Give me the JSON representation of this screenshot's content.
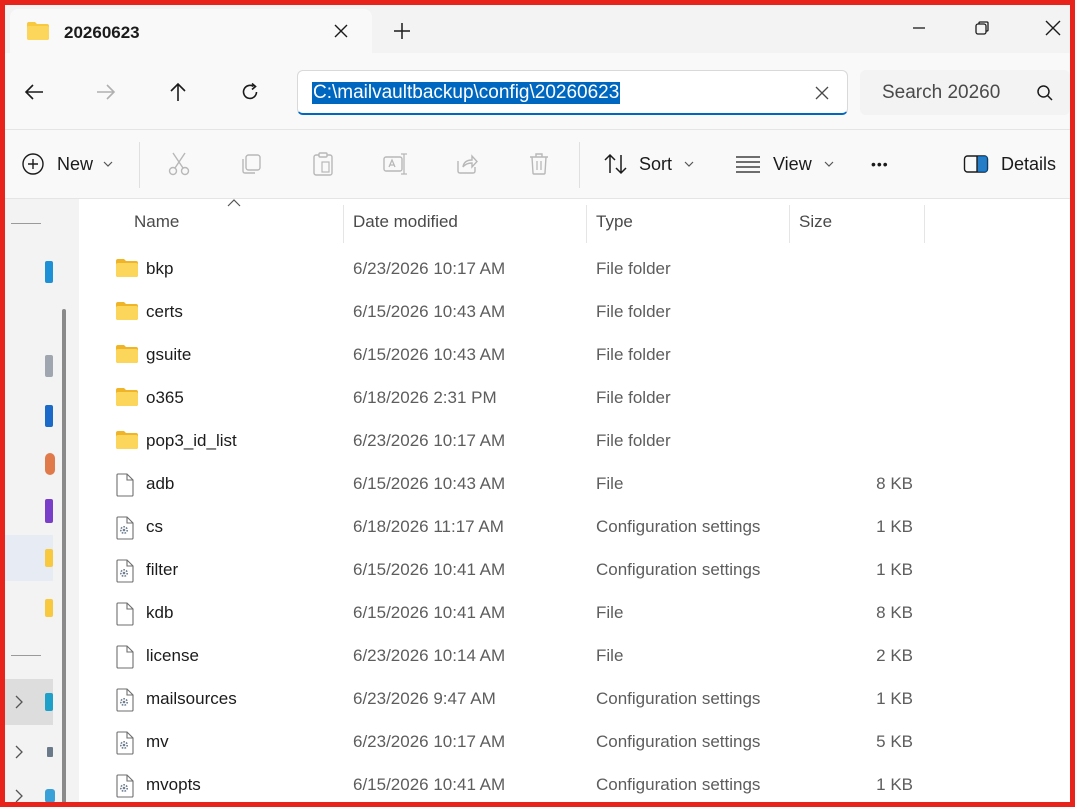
{
  "window": {
    "tab_title": "20260623",
    "new_tab_label": "+"
  },
  "nav": {
    "address": "C:\\mailvaultbackup\\config\\20260623",
    "search_placeholder": "Search 20260"
  },
  "toolbar": {
    "new_label": "New",
    "sort_label": "Sort",
    "view_label": "View",
    "more_label": "•••",
    "details_label": "Details"
  },
  "columns": {
    "name": "Name",
    "date": "Date modified",
    "type": "Type",
    "size": "Size"
  },
  "files": [
    {
      "name": "bkp",
      "date": "6/23/2026 10:17 AM",
      "type": "File folder",
      "size": "",
      "icon": "folder-icon"
    },
    {
      "name": "certs",
      "date": "6/15/2026 10:43 AM",
      "type": "File folder",
      "size": "",
      "icon": "folder-icon"
    },
    {
      "name": "gsuite",
      "date": "6/15/2026 10:43 AM",
      "type": "File folder",
      "size": "",
      "icon": "folder-icon"
    },
    {
      "name": "o365",
      "date": "6/18/2026 2:31 PM",
      "type": "File folder",
      "size": "",
      "icon": "folder-icon"
    },
    {
      "name": "pop3_id_list",
      "date": "6/23/2026 10:17 AM",
      "type": "File folder",
      "size": "",
      "icon": "folder-icon"
    },
    {
      "name": "adb",
      "date": "6/15/2026 10:43 AM",
      "type": "File",
      "size": "8 KB",
      "icon": "file-icon"
    },
    {
      "name": "cs",
      "date": "6/18/2026 11:17 AM",
      "type": "Configuration settings",
      "size": "1 KB",
      "icon": "config-file-icon"
    },
    {
      "name": "filter",
      "date": "6/15/2026 10:41 AM",
      "type": "Configuration settings",
      "size": "1 KB",
      "icon": "config-file-icon"
    },
    {
      "name": "kdb",
      "date": "6/15/2026 10:41 AM",
      "type": "File",
      "size": "8 KB",
      "icon": "file-icon"
    },
    {
      "name": "license",
      "date": "6/23/2026 10:14 AM",
      "type": "File",
      "size": "2 KB",
      "icon": "file-icon"
    },
    {
      "name": "mailsources",
      "date": "6/23/2026 9:47 AM",
      "type": "Configuration settings",
      "size": "1 KB",
      "icon": "config-file-icon"
    },
    {
      "name": "mv",
      "date": "6/23/2026 10:17 AM",
      "type": "Configuration settings",
      "size": "5 KB",
      "icon": "config-file-icon"
    },
    {
      "name": "mvopts",
      "date": "6/15/2026 10:41 AM",
      "type": "Configuration settings",
      "size": "1 KB",
      "icon": "config-file-icon"
    }
  ],
  "colors": {
    "accent": "#0067c0",
    "folder": "#f8c93e",
    "frame_border": "#e8231b"
  }
}
